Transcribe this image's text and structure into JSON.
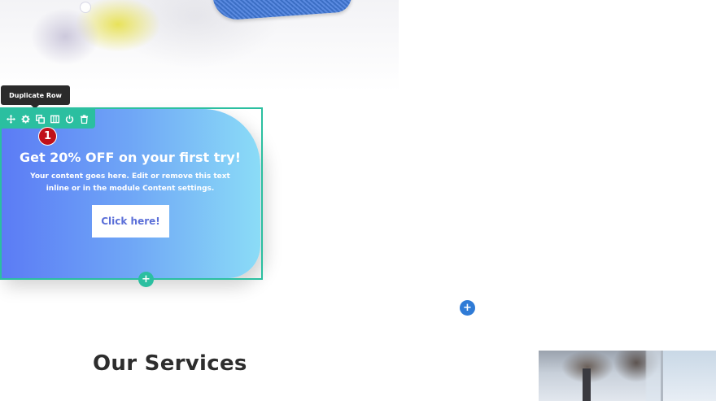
{
  "tooltip": {
    "text": "Duplicate Row"
  },
  "toolbar": {
    "icons": [
      "move-icon",
      "settings-icon",
      "duplicate-icon",
      "columns-icon",
      "power-icon",
      "trash-icon"
    ],
    "color": "#2bbfa0"
  },
  "step_badge": {
    "number": "1",
    "color": "#c0101a"
  },
  "promo": {
    "title": "Get 20% OFF on your first try!",
    "body": "Your content goes here. Edit or remove this text inline or in the module Content settings.",
    "button_label": "Click here!",
    "gradient_start": "#5b7bf5",
    "gradient_end": "#8bdcf7"
  },
  "add_module": {
    "label": "+",
    "color": "#2bbfa0"
  },
  "add_section": {
    "label": "+",
    "color": "#2f7bd6"
  },
  "services": {
    "heading": "Our Services"
  }
}
